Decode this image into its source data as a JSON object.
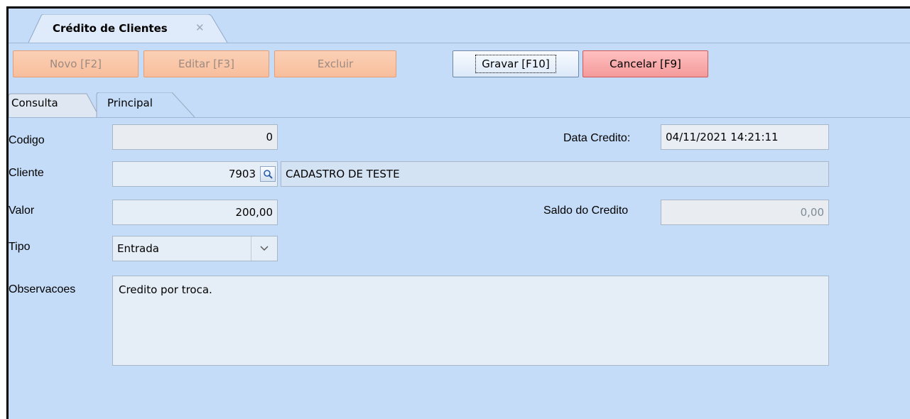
{
  "doc_tab": {
    "title": "Crédito de Clientes",
    "close_glyph": "✕"
  },
  "toolbar": {
    "novo": "Novo [F2]",
    "editar": "Editar [F3]",
    "excluir": "Excluir",
    "gravar": "Gravar [F10]",
    "cancelar": "Cancelar [F9]"
  },
  "tabs": [
    {
      "label": "Consulta",
      "active": false
    },
    {
      "label": "Principal",
      "active": true
    }
  ],
  "form": {
    "codigo": {
      "label": "Codigo",
      "value": "0"
    },
    "data_credito": {
      "label": "Data Credito:",
      "value": "04/11/2021 14:21:11"
    },
    "cliente": {
      "label": "Cliente",
      "code": "7903",
      "name": "CADASTRO DE TESTE",
      "lookup_icon": "magnifier-icon"
    },
    "valor": {
      "label": "Valor",
      "value": "200,00"
    },
    "saldo": {
      "label": "Saldo do Credito",
      "value": "0,00"
    },
    "tipo": {
      "label": "Tipo",
      "value": "Entrada",
      "dropdown_icon": "chevron-down-icon"
    },
    "observacoes": {
      "label": "Observacoes",
      "value": "Credito por troca."
    }
  },
  "colors": {
    "background": "#c4dcf8",
    "disabled_button": "#f9c6a8",
    "cancel_button": "#f6a6a6"
  }
}
